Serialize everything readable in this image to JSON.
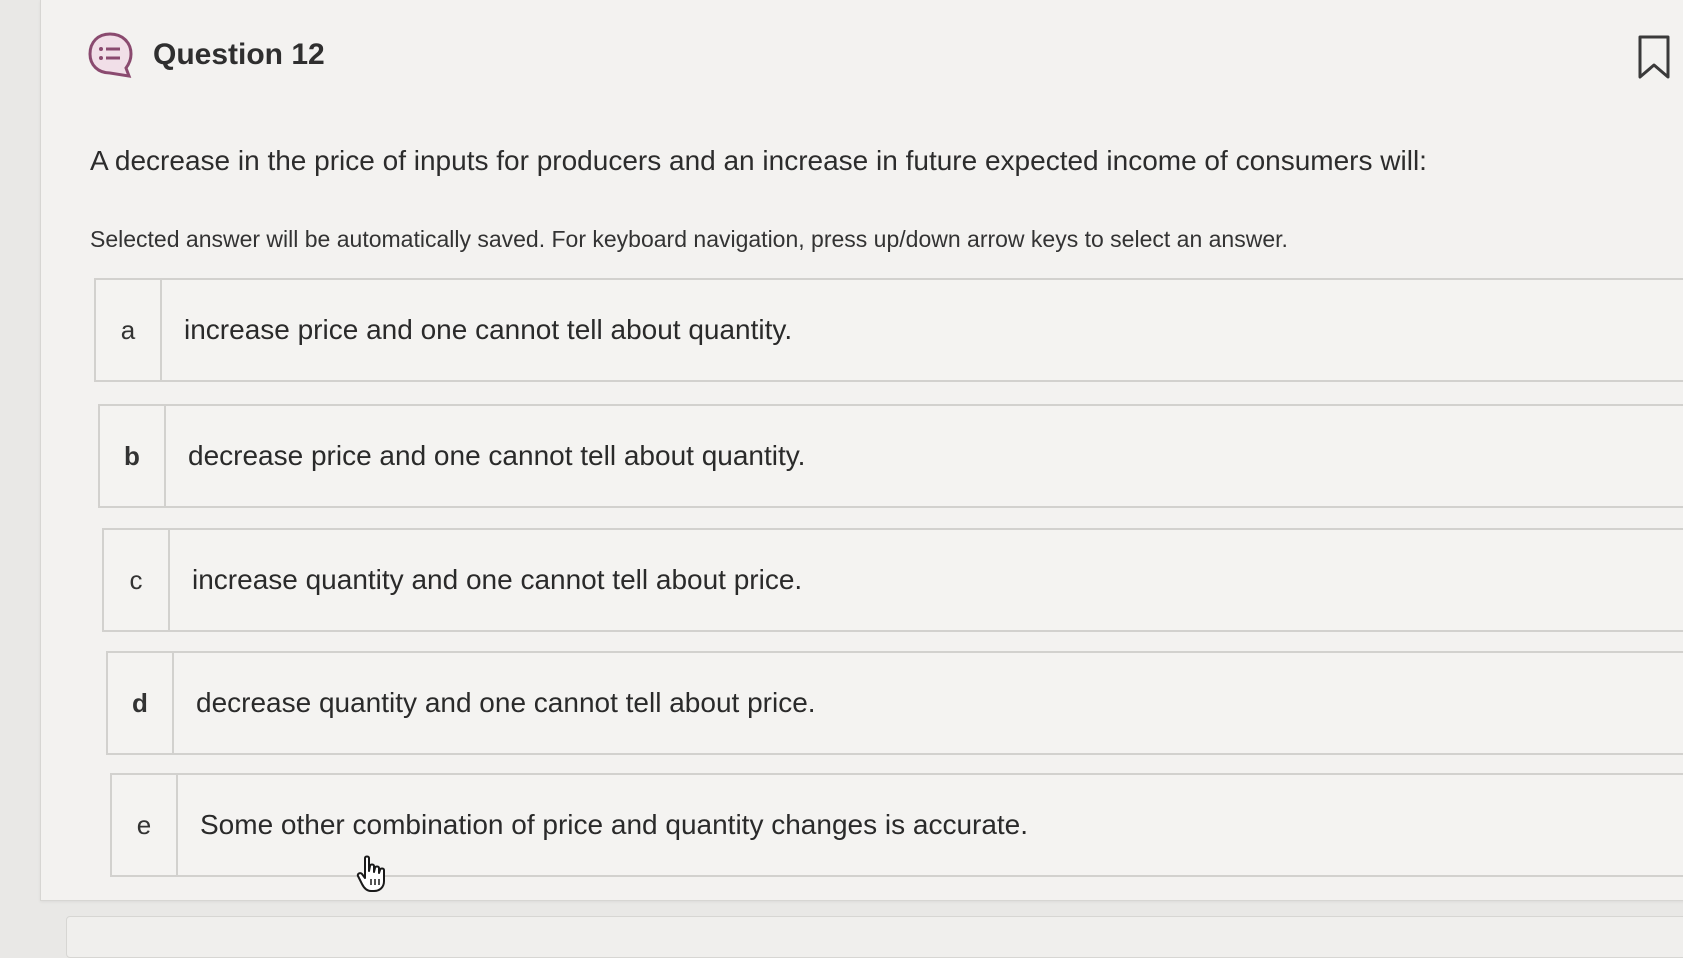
{
  "question": {
    "title": "Question 12",
    "prompt": "A decrease in the price of inputs for producers and an increase in future expected income of consumers will:",
    "instructions": "Selected answer will be automatically saved. For keyboard navigation, press up/down arrow keys to select an answer."
  },
  "icons": {
    "question_type": "list-speech-bubble-icon",
    "bookmark": "bookmark-icon",
    "cursor": "hand-pointer-icon"
  },
  "options": [
    {
      "letter": "a",
      "text": "increase price and one cannot tell about quantity."
    },
    {
      "letter": "b",
      "text": "decrease price and one cannot tell about quantity."
    },
    {
      "letter": "c",
      "text": "increase quantity and one cannot tell about price."
    },
    {
      "letter": "d",
      "text": "decrease quantity and one cannot tell about price."
    },
    {
      "letter": "e",
      "text": "Some other combination of price and quantity changes is accurate."
    }
  ],
  "colors": {
    "icon_accent": "#8a4a6f",
    "background": "#f3f2f0",
    "border": "#d2d1ce"
  }
}
